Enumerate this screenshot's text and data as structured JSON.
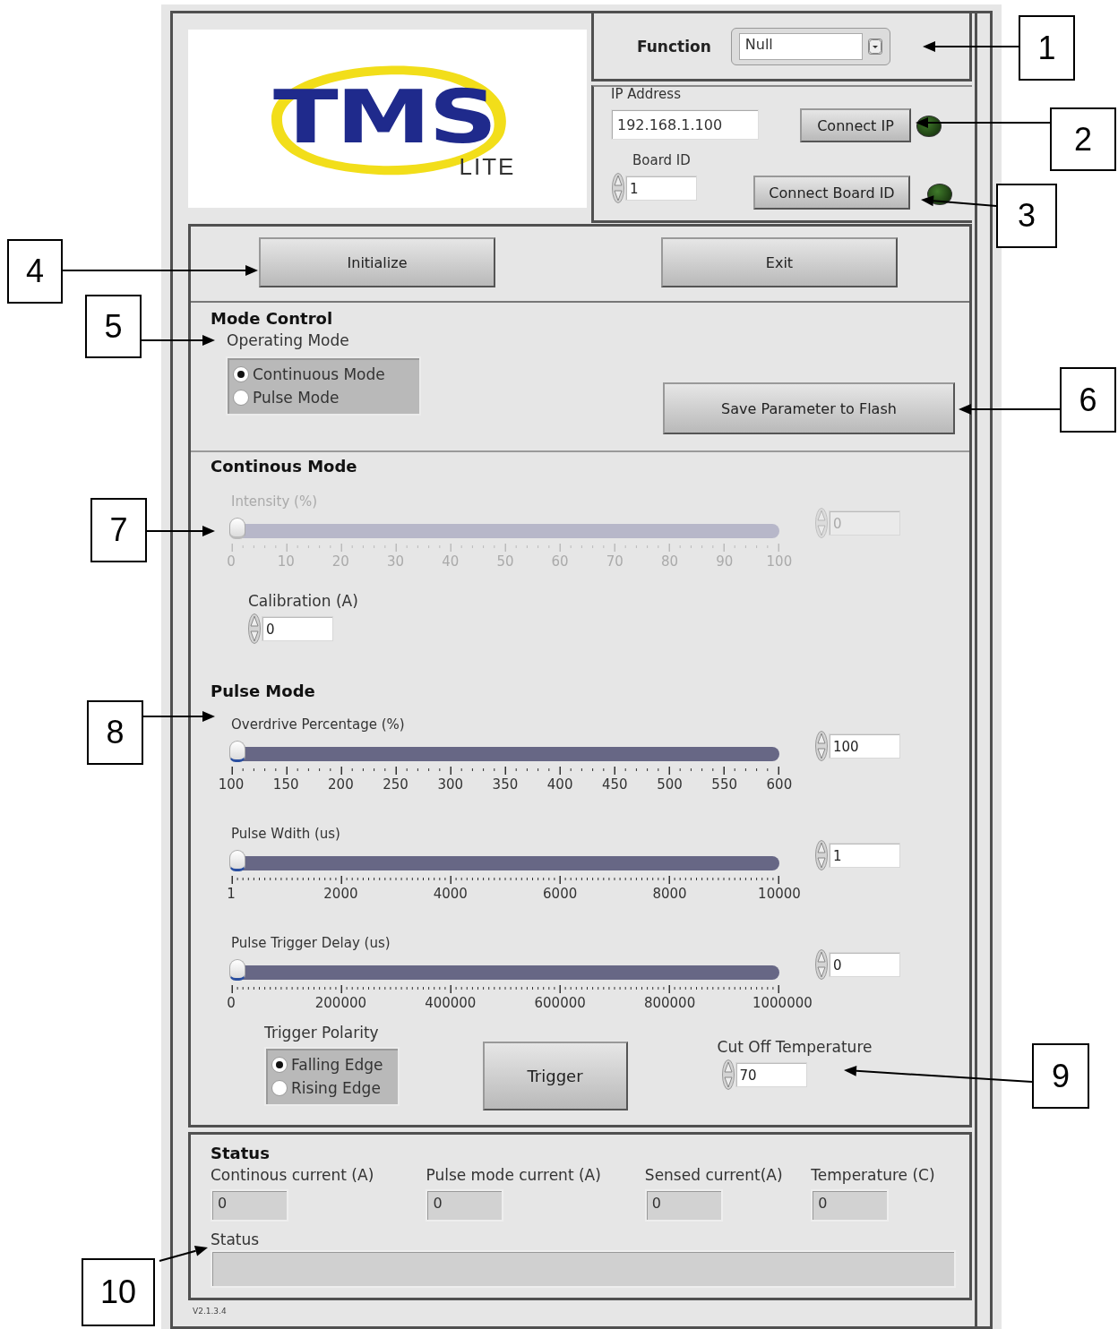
{
  "logo": {
    "title": "TMS",
    "subtitle": "LITE"
  },
  "function": {
    "label": "Function",
    "value": "Null"
  },
  "ip": {
    "label": "IP Address",
    "value": "192.168.1.100",
    "button": "Connect IP",
    "lit": false
  },
  "board": {
    "label": "Board ID",
    "value": "1",
    "button": "Connect Board ID",
    "lit": false
  },
  "actions": [
    "Initialize",
    "Exit"
  ],
  "mode_control": {
    "title": "Mode Control",
    "label": "Operating Mode",
    "options": [
      {
        "label": "Continuous Mode",
        "selected": true
      },
      {
        "label": "Pulse Mode",
        "selected": false
      }
    ],
    "save_button": "Save Parameter to Flash"
  },
  "continuous": {
    "title": "Continous Mode",
    "sliders": [
      {
        "label": "Intensity (%)",
        "disabled": true,
        "level": 0,
        "value": "0",
        "ticks": [
          "0",
          "10",
          "20",
          "30",
          "40",
          "50",
          "60",
          "70",
          "80",
          "90",
          "100"
        ]
      }
    ],
    "calibration": {
      "label": "Calibration (A)",
      "value": "0"
    }
  },
  "pulse": {
    "title": "Pulse Mode",
    "sliders": [
      {
        "label": "Overdrive Percentage (%)",
        "disabled": false,
        "level": 0,
        "value": "100",
        "ticks": [
          "100",
          "150",
          "200",
          "250",
          "300",
          "350",
          "400",
          "450",
          "500",
          "550",
          "600"
        ]
      },
      {
        "label": "Pulse Wdith (us)",
        "disabled": false,
        "level": 0,
        "value": "1",
        "ticks": [
          "1",
          "2000",
          "4000",
          "6000",
          "8000",
          "10000"
        ]
      },
      {
        "label": "Pulse Trigger Delay (us)",
        "disabled": false,
        "level": 0,
        "value": "0",
        "ticks": [
          "0",
          "200000",
          "400000",
          "600000",
          "800000",
          "1000000"
        ]
      }
    ],
    "trigger_polarity": {
      "label": "Trigger Polarity",
      "options": [
        {
          "label": "Falling Edge",
          "selected": true
        },
        {
          "label": "Rising Edge",
          "selected": false
        }
      ]
    },
    "trigger_button": "Trigger",
    "cutoff": {
      "label": "Cut Off Temperature",
      "value": "70"
    }
  },
  "status": {
    "title": "Status",
    "readouts": [
      {
        "label": "Continous current (A)",
        "value": "0"
      },
      {
        "label": "Pulse mode current (A)",
        "value": "0"
      },
      {
        "label": "Sensed current(A)",
        "value": "0"
      },
      {
        "label": "Temperature (C)",
        "value": "0"
      }
    ],
    "message_label": "Status"
  },
  "version": "V2.1.3.4",
  "callouts": [
    "1",
    "2",
    "3",
    "4",
    "5",
    "6",
    "7",
    "8",
    "9",
    "10"
  ]
}
